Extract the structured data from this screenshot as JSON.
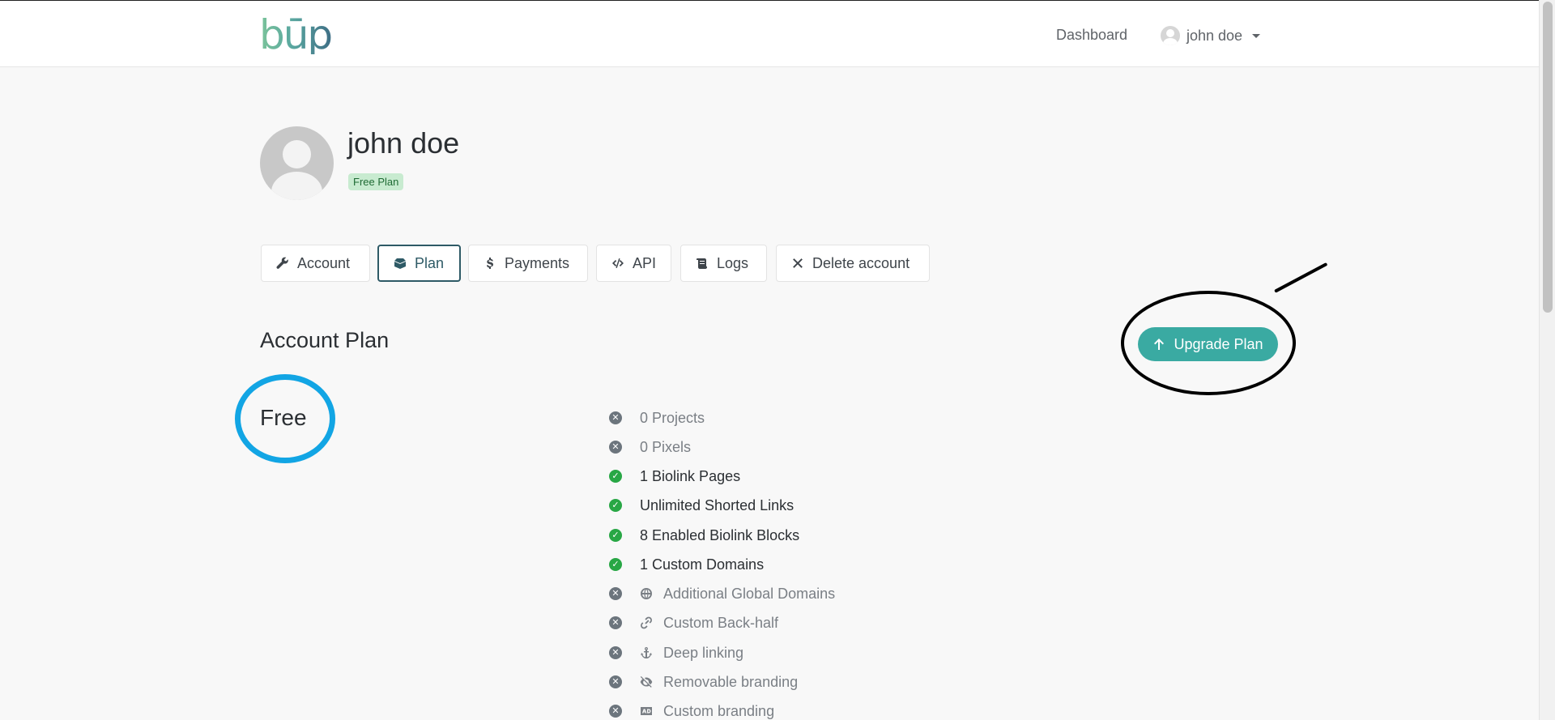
{
  "navbar": {
    "logo_text": "būp",
    "dashboard_label": "Dashboard",
    "user_name": "john doe"
  },
  "profile": {
    "name": "john doe",
    "plan_badge": "Free Plan"
  },
  "tabs": [
    {
      "label": "Account",
      "icon": "wrench-icon",
      "active": false
    },
    {
      "label": "Plan",
      "icon": "box-icon",
      "active": true
    },
    {
      "label": "Payments",
      "icon": "dollar-icon",
      "active": false
    },
    {
      "label": "API",
      "icon": "code-icon",
      "active": false
    },
    {
      "label": "Logs",
      "icon": "scroll-icon",
      "active": false
    },
    {
      "label": "Delete account",
      "icon": "close-icon",
      "active": false
    }
  ],
  "plan": {
    "section_title": "Account Plan",
    "current_plan": "Free",
    "upgrade_label": "Upgrade Plan"
  },
  "features": [
    {
      "count": "0",
      "label": "Projects",
      "enabled": false
    },
    {
      "count": "0",
      "label": "Pixels",
      "enabled": false
    },
    {
      "count": "1",
      "label": "Biolink Pages",
      "enabled": true
    },
    {
      "count": "Unlimited",
      "label": "Shorted Links",
      "enabled": true
    },
    {
      "count": "8",
      "label": "Enabled Biolink Blocks",
      "enabled": true
    },
    {
      "count": "1",
      "label": "Custom Domains",
      "enabled": true
    },
    {
      "label": "Additional Global Domains",
      "icon": "globe-icon",
      "enabled": false
    },
    {
      "label": "Custom Back-half",
      "icon": "link-icon",
      "enabled": false
    },
    {
      "label": "Deep linking",
      "icon": "anchor-icon",
      "enabled": false
    },
    {
      "label": "Removable branding",
      "icon": "eye-slash-icon",
      "enabled": false
    },
    {
      "label": "Custom branding",
      "icon": "ad-icon",
      "enabled": false
    }
  ],
  "colors": {
    "accent": "#3aaaa2",
    "active_tab": "#2e5a66",
    "enabled": "#28a745",
    "disabled": "#6c757d",
    "annotation_blue": "#12a5e4"
  }
}
